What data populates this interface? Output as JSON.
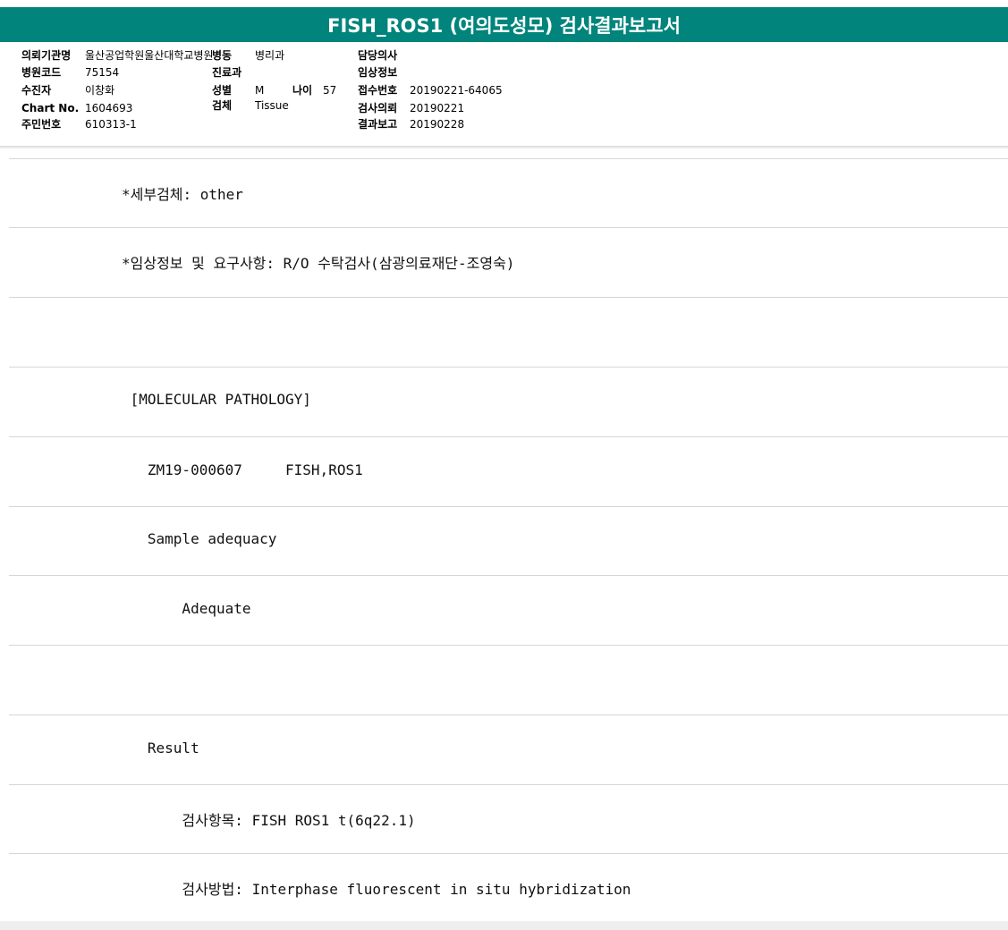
{
  "report": {
    "title": "FISH_ROS1 (여의도성모) 검사결과보고서"
  },
  "header": {
    "institution_label": "의뢰기관명",
    "institution_value": "울산공업학원울산대학교병원",
    "ward_label": "병동",
    "ward_value": "병리과",
    "doctor_label": "담당의사",
    "doctor_value": "",
    "hospital_code_label": "병원코드",
    "hospital_code_value": "75154",
    "dept_label": "진료과",
    "dept_value": "",
    "clinical_label": "임상정보",
    "clinical_value": "",
    "patient_label": "수진자",
    "patient_value": "이창화",
    "sex_label": "성별",
    "sex_value": "M",
    "age_label": "나이",
    "age_value": "57",
    "receipt_label": "접수번호",
    "receipt_value": "20190221-64065",
    "chart_label": "Chart No.",
    "chart_value": "1604693",
    "specimen_label": "검체",
    "specimen_value": "Tissue",
    "request_label": "검사의뢰",
    "request_value": "20190221",
    "rrn_label": "주민번호",
    "rrn_value": "610313-1",
    "result_date_label": "결과보고",
    "result_date_value": "20190228"
  },
  "lines": [
    "*세부검체: other",
    "*임상정보 및 요구사항: R/O 수탁검사(삼광의료재단-조영숙)",
    "",
    " [MOLECULAR PATHOLOGY]",
    "   ZM19-000607     FISH,ROS1",
    "   Sample adequacy",
    "       Adequate",
    "",
    "   Result",
    "       검사항목: FISH ROS1 t(6q22.1)",
    "       검사방법: Interphase fluorescent in situ hybridization"
  ]
}
